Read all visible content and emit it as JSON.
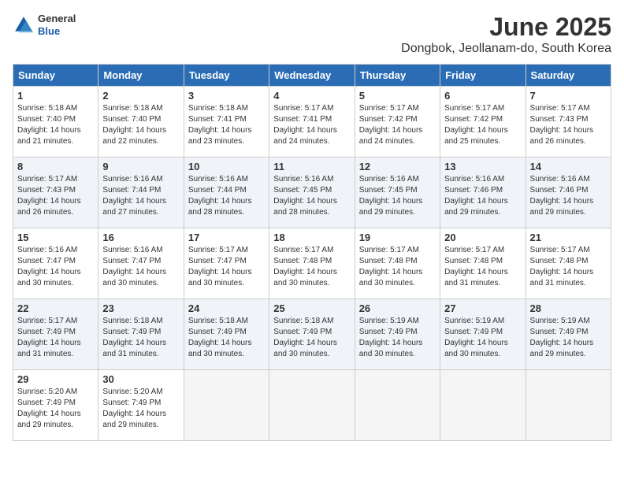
{
  "logo": {
    "general": "General",
    "blue": "Blue"
  },
  "title": "June 2025",
  "subtitle": "Dongbok, Jeollanam-do, South Korea",
  "headers": [
    "Sunday",
    "Monday",
    "Tuesday",
    "Wednesday",
    "Thursday",
    "Friday",
    "Saturday"
  ],
  "weeks": [
    [
      {
        "day": "1",
        "info": "Sunrise: 5:18 AM\nSunset: 7:40 PM\nDaylight: 14 hours\nand 21 minutes."
      },
      {
        "day": "2",
        "info": "Sunrise: 5:18 AM\nSunset: 7:40 PM\nDaylight: 14 hours\nand 22 minutes."
      },
      {
        "day": "3",
        "info": "Sunrise: 5:18 AM\nSunset: 7:41 PM\nDaylight: 14 hours\nand 23 minutes."
      },
      {
        "day": "4",
        "info": "Sunrise: 5:17 AM\nSunset: 7:41 PM\nDaylight: 14 hours\nand 24 minutes."
      },
      {
        "day": "5",
        "info": "Sunrise: 5:17 AM\nSunset: 7:42 PM\nDaylight: 14 hours\nand 24 minutes."
      },
      {
        "day": "6",
        "info": "Sunrise: 5:17 AM\nSunset: 7:42 PM\nDaylight: 14 hours\nand 25 minutes."
      },
      {
        "day": "7",
        "info": "Sunrise: 5:17 AM\nSunset: 7:43 PM\nDaylight: 14 hours\nand 26 minutes."
      }
    ],
    [
      {
        "day": "8",
        "info": "Sunrise: 5:17 AM\nSunset: 7:43 PM\nDaylight: 14 hours\nand 26 minutes."
      },
      {
        "day": "9",
        "info": "Sunrise: 5:16 AM\nSunset: 7:44 PM\nDaylight: 14 hours\nand 27 minutes."
      },
      {
        "day": "10",
        "info": "Sunrise: 5:16 AM\nSunset: 7:44 PM\nDaylight: 14 hours\nand 28 minutes."
      },
      {
        "day": "11",
        "info": "Sunrise: 5:16 AM\nSunset: 7:45 PM\nDaylight: 14 hours\nand 28 minutes."
      },
      {
        "day": "12",
        "info": "Sunrise: 5:16 AM\nSunset: 7:45 PM\nDaylight: 14 hours\nand 29 minutes."
      },
      {
        "day": "13",
        "info": "Sunrise: 5:16 AM\nSunset: 7:46 PM\nDaylight: 14 hours\nand 29 minutes."
      },
      {
        "day": "14",
        "info": "Sunrise: 5:16 AM\nSunset: 7:46 PM\nDaylight: 14 hours\nand 29 minutes."
      }
    ],
    [
      {
        "day": "15",
        "info": "Sunrise: 5:16 AM\nSunset: 7:47 PM\nDaylight: 14 hours\nand 30 minutes."
      },
      {
        "day": "16",
        "info": "Sunrise: 5:16 AM\nSunset: 7:47 PM\nDaylight: 14 hours\nand 30 minutes."
      },
      {
        "day": "17",
        "info": "Sunrise: 5:17 AM\nSunset: 7:47 PM\nDaylight: 14 hours\nand 30 minutes."
      },
      {
        "day": "18",
        "info": "Sunrise: 5:17 AM\nSunset: 7:48 PM\nDaylight: 14 hours\nand 30 minutes."
      },
      {
        "day": "19",
        "info": "Sunrise: 5:17 AM\nSunset: 7:48 PM\nDaylight: 14 hours\nand 30 minutes."
      },
      {
        "day": "20",
        "info": "Sunrise: 5:17 AM\nSunset: 7:48 PM\nDaylight: 14 hours\nand 31 minutes."
      },
      {
        "day": "21",
        "info": "Sunrise: 5:17 AM\nSunset: 7:48 PM\nDaylight: 14 hours\nand 31 minutes."
      }
    ],
    [
      {
        "day": "22",
        "info": "Sunrise: 5:17 AM\nSunset: 7:49 PM\nDaylight: 14 hours\nand 31 minutes."
      },
      {
        "day": "23",
        "info": "Sunrise: 5:18 AM\nSunset: 7:49 PM\nDaylight: 14 hours\nand 31 minutes."
      },
      {
        "day": "24",
        "info": "Sunrise: 5:18 AM\nSunset: 7:49 PM\nDaylight: 14 hours\nand 30 minutes."
      },
      {
        "day": "25",
        "info": "Sunrise: 5:18 AM\nSunset: 7:49 PM\nDaylight: 14 hours\nand 30 minutes."
      },
      {
        "day": "26",
        "info": "Sunrise: 5:19 AM\nSunset: 7:49 PM\nDaylight: 14 hours\nand 30 minutes."
      },
      {
        "day": "27",
        "info": "Sunrise: 5:19 AM\nSunset: 7:49 PM\nDaylight: 14 hours\nand 30 minutes."
      },
      {
        "day": "28",
        "info": "Sunrise: 5:19 AM\nSunset: 7:49 PM\nDaylight: 14 hours\nand 29 minutes."
      }
    ],
    [
      {
        "day": "29",
        "info": "Sunrise: 5:20 AM\nSunset: 7:49 PM\nDaylight: 14 hours\nand 29 minutes."
      },
      {
        "day": "30",
        "info": "Sunrise: 5:20 AM\nSunset: 7:49 PM\nDaylight: 14 hours\nand 29 minutes."
      },
      {
        "day": "",
        "info": ""
      },
      {
        "day": "",
        "info": ""
      },
      {
        "day": "",
        "info": ""
      },
      {
        "day": "",
        "info": ""
      },
      {
        "day": "",
        "info": ""
      }
    ]
  ]
}
